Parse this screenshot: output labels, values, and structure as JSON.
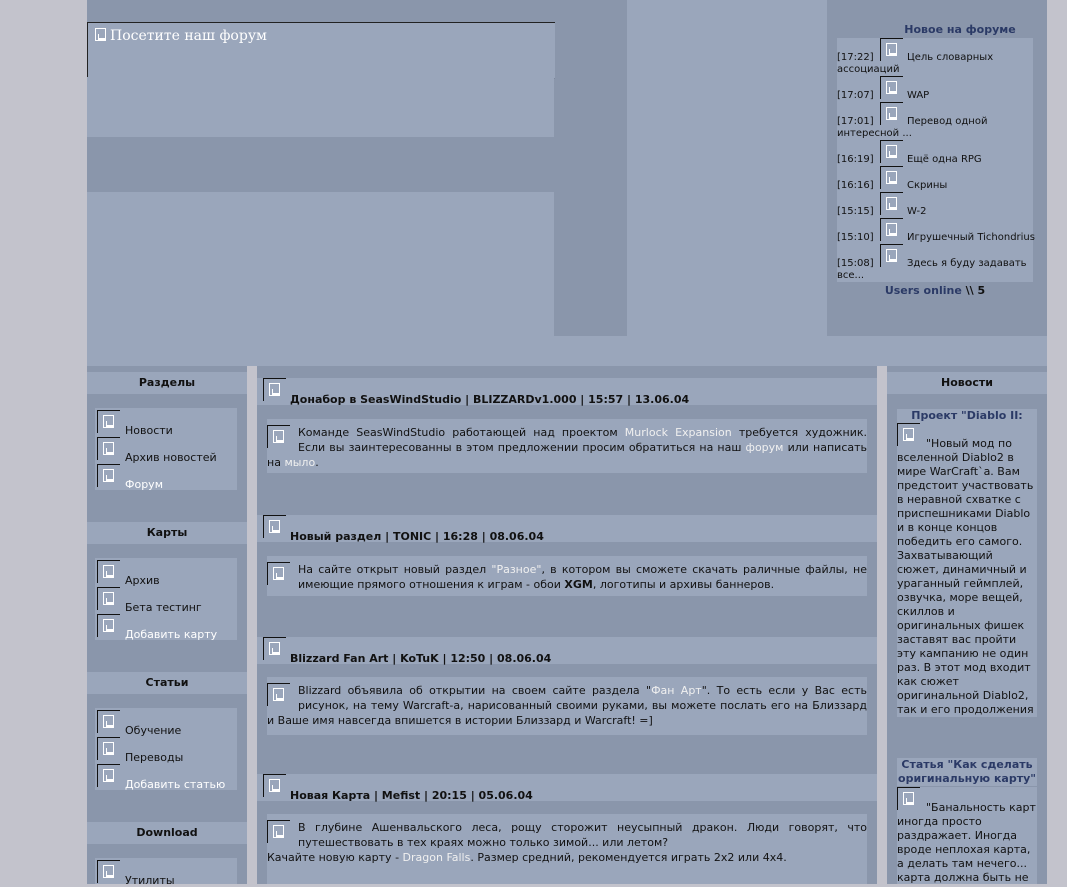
{
  "banner": {
    "text": "Посетите наш форум"
  },
  "forum": {
    "title": "Новое на форуме",
    "items": [
      {
        "time": "[17:22]",
        "label": "Цель словарных",
        "more": "ассоциаций"
      },
      {
        "time": "[17:07]",
        "label": "WAP",
        "more": ""
      },
      {
        "time": "[17:01]",
        "label": "Перевод одной",
        "more": "интересной ..."
      },
      {
        "time": "[16:19]",
        "label": "Ещё одна RPG",
        "more": ""
      },
      {
        "time": "[16:16]",
        "label": "Скрины",
        "more": ""
      },
      {
        "time": "[15:15]",
        "label": "W-2",
        "more": ""
      },
      {
        "time": "[15:10]",
        "label": "Игрушечный Tichondrius",
        "more": ""
      },
      {
        "time": "[15:08]",
        "label": "Здесь я буду задавать",
        "more": "все..."
      }
    ],
    "online_label": "Users online",
    "online_sep": "\\\\",
    "online_count": "5"
  },
  "sections": [
    {
      "title": "Разделы",
      "items": [
        "Новости",
        "Архив новостей",
        "Форум"
      ],
      "active": 2
    },
    {
      "title": "Карты",
      "items": [
        "Архив",
        "Бета тестинг",
        "Добавить карту"
      ],
      "active": 2
    },
    {
      "title": "Статьи",
      "items": [
        "Обучение",
        "Переводы",
        "Добавить статью"
      ],
      "active": 2
    },
    {
      "title": "Download",
      "items": [
        "Утилиты"
      ],
      "active": -1
    }
  ],
  "news": [
    {
      "title": "Донабор в SeasWindStudio | BLIZZARDv1.000 | 15:57 | 13.06.04",
      "p1": "Команде SeasWindStudio работающей над проектом ",
      "l1": "Murlock Expansion",
      "p2": " требуется художник. Если вы заинтересованны в этом предложении просим обратиться на наш ",
      "l2": "форум",
      "p3": " или написать на ",
      "l3": "мыло",
      "p4": "."
    },
    {
      "title": "Новый раздел | TONIC | 16:28 | 08.06.04",
      "p1": "На сайте открыт новый раздел ",
      "l1": "\"Разное\"",
      "p2": ", в котором вы сможете скачать раличные файлы, не имеющие прямого отношения к играм - обои ",
      "b1": "XGM",
      "p3": ", логотипы и архивы баннеров."
    },
    {
      "title": "Blizzard Fan Art | KoTuK | 12:50 | 08.06.04",
      "p1": "Blizzard объявила об открытии на своем сайте раздела \"",
      "l1": "Фан Арт",
      "p2": "\". То есть если у Вас есть рисунок, на тему Warcraft-а, нарисованный своими руками, вы можете послать его на Близзард и Ваше имя навсегда впишется в истории Близзард и Warcraft! =]"
    },
    {
      "title": "Новая Карта | Mefist | 20:15 | 05.06.04",
      "p1": "В глубине Ашенвальского леса, рощу сторожит неусыпный дракон. Люди говорят, что путешествовать в тех краях можно только зимой... или летом?",
      "p2": "Качайте новую карту - ",
      "l1": "Dragon Falls",
      "p3": ". Размер средний, рекомендуется играть 2х2 или 4х4."
    }
  ],
  "right": {
    "title": "Новости",
    "articles": [
      {
        "title": "Проект \"Diablo II: LoD\"",
        "text": "\"Новый мод по вселенной Diablo2 в мире WarCraft`а. Вам предстоит участвовать в неравной схватке с приспешниками Diablo и в конце концов победить его самого. Захватывающий сюжет, динамичный и ураганный геймплей, озвучка, море вещей, скиллов и оригинальных фишек заставят вас пройти эту кампанию не один раз. В этот мод входит как сюжет оригинальной Diablo2, так и его продолжения Lord of Destruction.\""
      },
      {
        "title": "Статья \"Как сделать оригинальную карту\"",
        "text": "\"Банальность карт иногда просто раздражает. Иногда вроде неплохая карта, а делать там нечего... карта должна быть не"
      }
    ]
  }
}
